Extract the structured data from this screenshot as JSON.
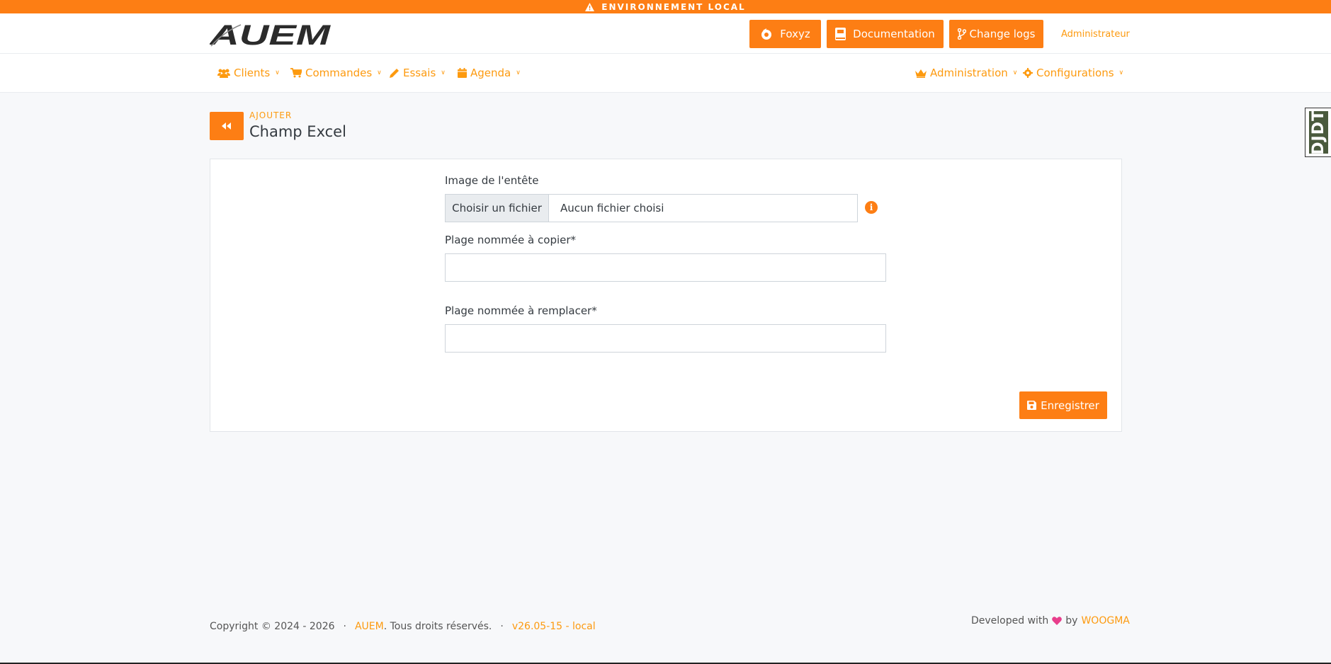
{
  "banner": {
    "text": "ENVIRONNEMENT LOCAL",
    "icon": "warning-icon"
  },
  "header": {
    "logo_text": "AUEM",
    "buttons": [
      {
        "label": "Foxyz",
        "icon": "foxyz-icon"
      },
      {
        "label": "Documentation",
        "icon": "book-icon"
      },
      {
        "label": "Change logs",
        "icon": "code-branch-icon"
      }
    ],
    "user_link": "Administrateur"
  },
  "nav": {
    "left": [
      {
        "label": "Clients",
        "icon": "users-icon"
      },
      {
        "label": "Commandes",
        "icon": "cart-icon"
      },
      {
        "label": "Essais",
        "icon": "pencil-icon"
      },
      {
        "label": "Agenda",
        "icon": "calendar-icon"
      }
    ],
    "right": [
      {
        "label": "Administration",
        "icon": "crown-icon"
      },
      {
        "label": "Configurations",
        "icon": "gear-icon"
      }
    ]
  },
  "page": {
    "kicker": "AJOUTER",
    "title": "Champ Excel"
  },
  "debug_toolbar": {
    "label": "DJDT"
  },
  "form": {
    "image_label": "Image de l'entête",
    "file_button": "Choisir un fichier",
    "file_status": "Aucun fichier choisi",
    "copier_label": "Plage nommée à copier*",
    "copier_value": "",
    "remplacer_label": "Plage nommée à remplacer*",
    "remplacer_value": "",
    "save_label": "Enregistrer"
  },
  "footer": {
    "copyright": "Copyright © 2024 - 2026",
    "brand": "AUEM",
    "rights": ". Tous droits réservés.",
    "version": "v26.05-15 - local",
    "developed_prefix": "Developed with",
    "developed_by": "by",
    "company": "WOOGMA"
  },
  "colors": {
    "accent": "#fd7e14",
    "link": "#fd9a0f",
    "heart": "#e83e8c"
  }
}
